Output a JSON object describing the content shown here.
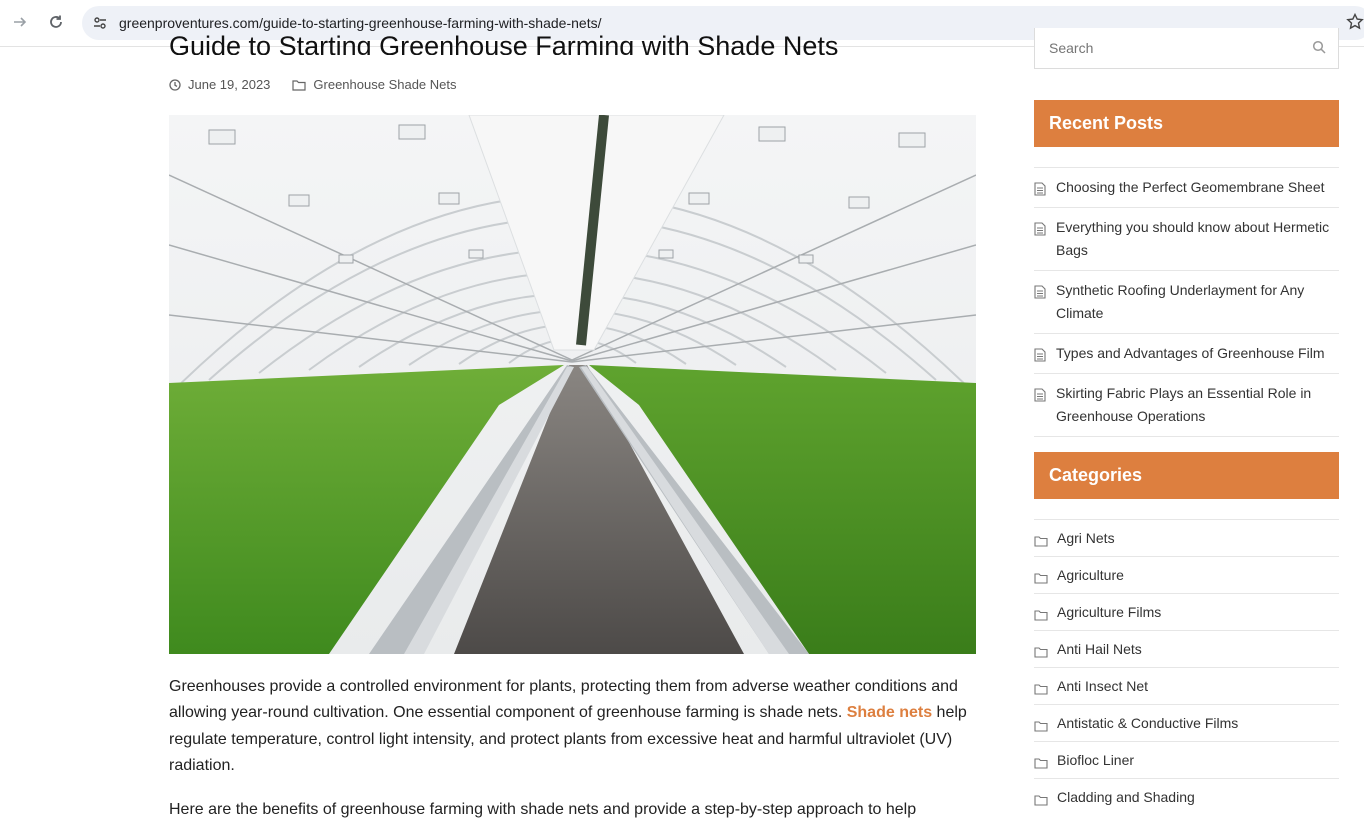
{
  "browser": {
    "url": "greenproventures.com/guide-to-starting-greenhouse-farming-with-shade-nets/"
  },
  "article": {
    "title": "Guide to Starting Greenhouse Farming with Shade Nets",
    "date": "June 19, 2023",
    "category": "Greenhouse Shade Nets",
    "p1_before": "Greenhouses provide a controlled environment for plants, protecting them from adverse weather conditions and allowing year-round cultivation. One essential component of greenhouse farming is shade nets. ",
    "p1_link": "Shade nets",
    "p1_after": " help regulate temperature, control light intensity, and protect plants from excessive heat and harmful ultraviolet (UV) radiation.",
    "p2": "Here are the benefits of greenhouse farming with shade nets and provide a step-by-step approach to help"
  },
  "sidebar": {
    "search_placeholder": "Search",
    "recent_title": "Recent Posts",
    "recent_posts": [
      "Choosing the Perfect Geomembrane Sheet",
      "Everything you should know about Hermetic Bags",
      "Synthetic Roofing Underlayment for Any Climate",
      "Types and Advantages of Greenhouse Film",
      "Skirting Fabric Plays an Essential Role in Greenhouse Operations"
    ],
    "categories_title": "Categories",
    "categories": [
      "Agri Nets",
      "Agriculture",
      "Agriculture Films",
      "Anti Hail Nets",
      "Anti Insect Net",
      "Antistatic & Conductive Films",
      "Biofloc Liner",
      "Cladding and Shading"
    ]
  },
  "colors": {
    "accent": "#dd7f3f"
  }
}
